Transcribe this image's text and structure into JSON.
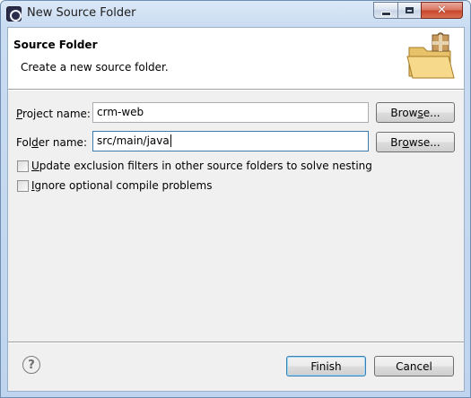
{
  "window": {
    "title": "New Source Folder",
    "app_icon": "eclipse-icon",
    "controls": {
      "minimize": "minimize-icon",
      "maximize": "maximize-icon",
      "close": "close-icon"
    }
  },
  "header": {
    "title": "Source Folder",
    "description": "Create a new source folder.",
    "icon": "folder-package-icon"
  },
  "form": {
    "project": {
      "label_pre": "",
      "label_mnemonic": "P",
      "label_post": "roject name:",
      "value": "crm-web"
    },
    "folder": {
      "label_pre": "Fol",
      "label_mnemonic": "d",
      "label_post": "er name:",
      "value": "src/main/java"
    },
    "browse_project": {
      "pre": "Brow",
      "mnemonic": "s",
      "post": "e..."
    },
    "browse_folder": {
      "pre": "Br",
      "mnemonic": "o",
      "post": "wse..."
    }
  },
  "options": [
    {
      "mnemonic": "U",
      "rest": "pdate exclusion filters in other source folders to solve nesting",
      "checked": false
    },
    {
      "mnemonic": "I",
      "rest": "gnore optional compile problems",
      "checked": false
    }
  ],
  "footer": {
    "help_glyph": "?",
    "finish_label": "Finish",
    "cancel_label": "Cancel"
  }
}
